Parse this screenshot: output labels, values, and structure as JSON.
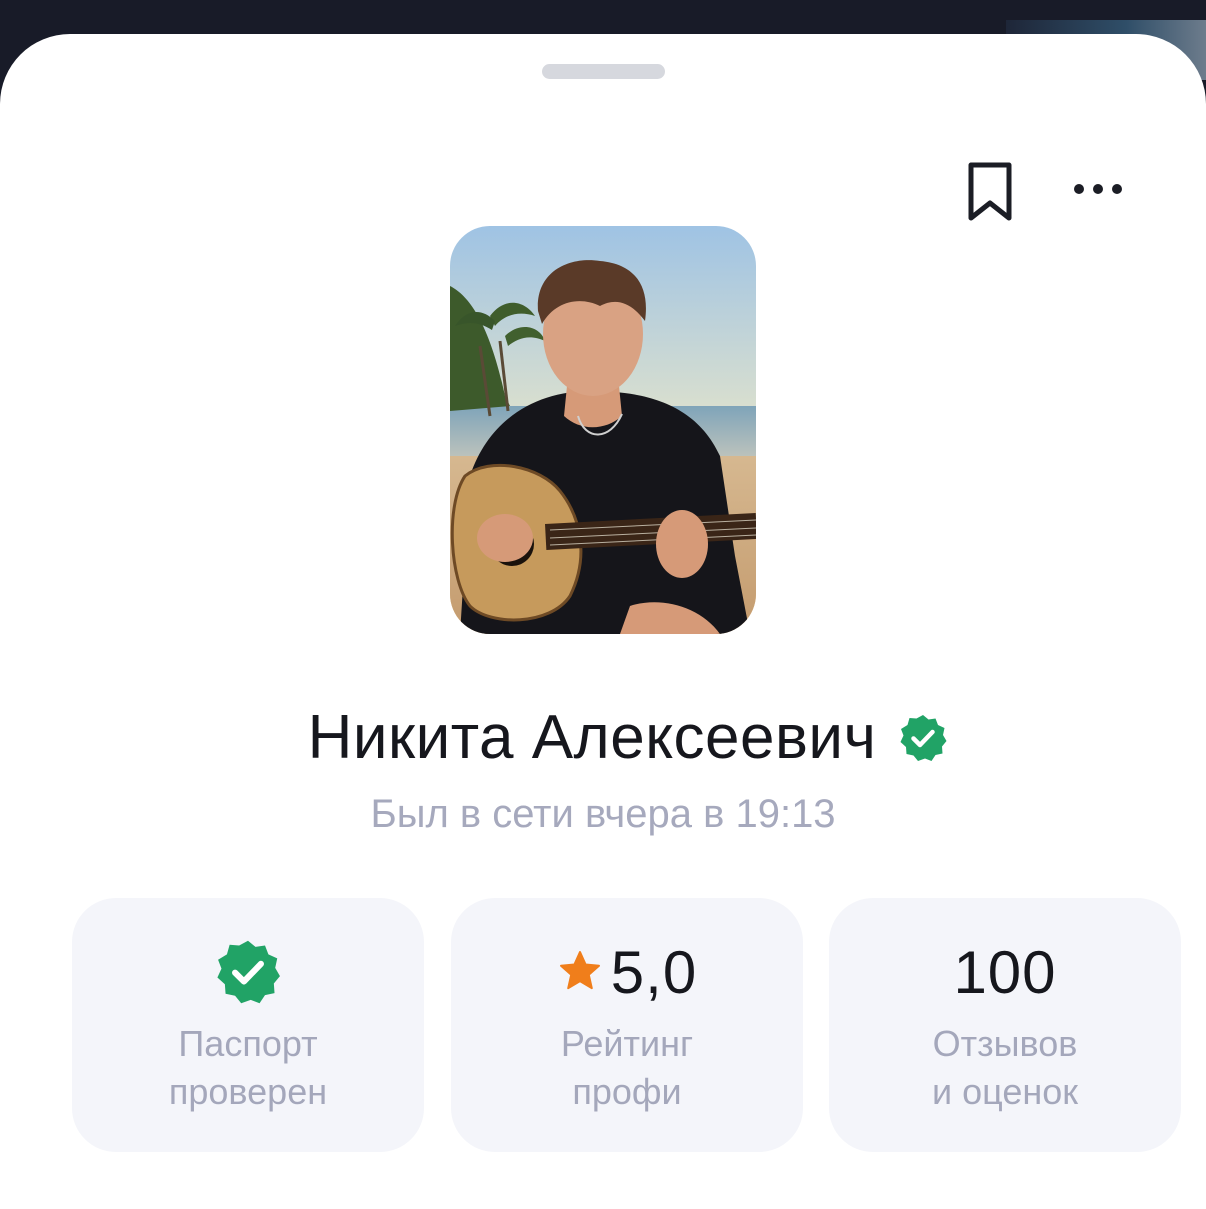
{
  "header": {
    "bookmark_icon": "bookmark-icon",
    "more_icon": "more-horizontal-icon"
  },
  "profile": {
    "photo_alt": "Фото профиля",
    "name": "Никита Алексеевич",
    "verified_icon": "verified-check-icon",
    "verified_color": "#21a366",
    "last_seen": "Был в сети вчера в 19:13"
  },
  "stats": [
    {
      "icon": "verified-check-icon",
      "value": "",
      "label_line1": "Паспорт",
      "label_line2": "проверен"
    },
    {
      "icon": "star-icon",
      "icon_color": "#f07e1b",
      "value": "5,0",
      "label_line1": "Рейтинг",
      "label_line2": "профи"
    },
    {
      "icon": "",
      "value": "100",
      "label_line1": "Отзывов",
      "label_line2": "и оценок"
    }
  ],
  "colors": {
    "card_bg": "#f4f5fa",
    "muted_text": "#a6a9bd",
    "primary_text": "#16171d"
  }
}
